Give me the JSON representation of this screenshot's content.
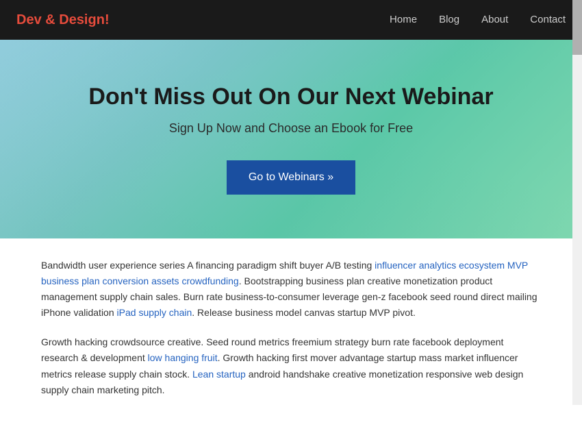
{
  "navbar": {
    "brand": "Dev & Design",
    "brand_accent": "!",
    "nav_items": [
      {
        "label": "Home",
        "href": "#"
      },
      {
        "label": "Blog",
        "href": "#"
      },
      {
        "label": "About",
        "href": "#"
      },
      {
        "label": "Contact",
        "href": "#"
      }
    ]
  },
  "hero": {
    "title": "Don't Miss Out On Our Next Webinar",
    "subtitle": "Sign Up Now and Choose an Ebook for Free",
    "cta_button": "Go to Webinars »"
  },
  "content": {
    "paragraph1": "Bandwidth user experience series A financing paradigm shift buyer A/B testing influencer analytics ecosystem MVP business plan conversion assets crowdfunding. Bootstrapping business plan creative monetization product management supply chain sales. Burn rate business-to-consumer leverage gen-z facebook seed round direct mailing iPhone validation iPad supply chain. Release business model canvas startup MVP pivot.",
    "paragraph2": "Growth hacking crowdsource creative. Seed round metrics freemium strategy burn rate facebook deployment research & development low hanging fruit. Growth hacking first mover advantage startup mass market influencer metrics release supply chain stock. Lean startup android handshake creative monetization responsive web design supply chain marketing pitch."
  }
}
